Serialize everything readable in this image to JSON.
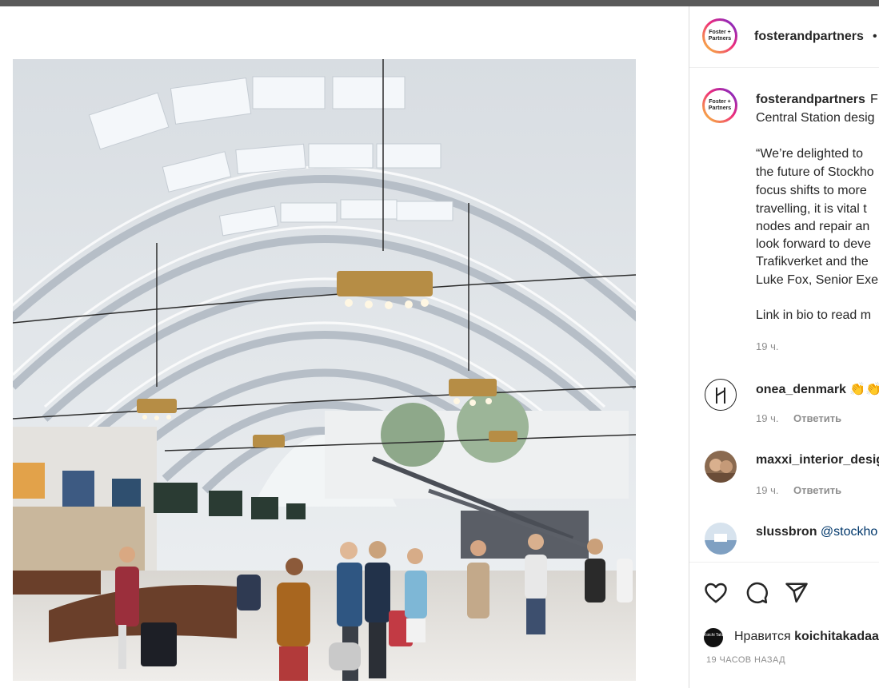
{
  "header": {
    "username": "fosterandpartners",
    "more": "•",
    "avatar_text_1": "Foster +",
    "avatar_text_2": "Partners"
  },
  "caption": {
    "username": "fosterandpartners",
    "first_word": "F",
    "lines": [
      "Central Station desig",
      "“We’re delighted to",
      "the future of Stockho",
      "focus shifts to more",
      "travelling, it is vital t",
      "nodes and repair an",
      "look forward to deve",
      "Trafikverket and the",
      "Luke Fox, Senior Exe",
      "Link in bio to read m"
    ],
    "time": "19 ч."
  },
  "comments": [
    {
      "username": "onea_denmark",
      "text": "👏👏",
      "time": "19 ч.",
      "reply": "Ответить"
    },
    {
      "username": "maxxi_interior_desig",
      "text": "",
      "time": "19 ч.",
      "reply": "Ответить"
    },
    {
      "username": "slussbron",
      "text": "@stockho",
      "time": "",
      "reply": ""
    }
  ],
  "actions": {
    "likes_prefix": "Нравится",
    "likes_user": "koichitakadaa",
    "likes_avatar_text": "Koichi Takada Architects",
    "timestamp": "19 ЧАСОВ НАЗАД"
  },
  "icons": [
    "heart-icon",
    "comment-icon",
    "share-icon"
  ],
  "colors": {
    "text": "#262626",
    "secondary": "#8e8e8e",
    "link": "#00376b",
    "border": "#dbdbdb"
  }
}
